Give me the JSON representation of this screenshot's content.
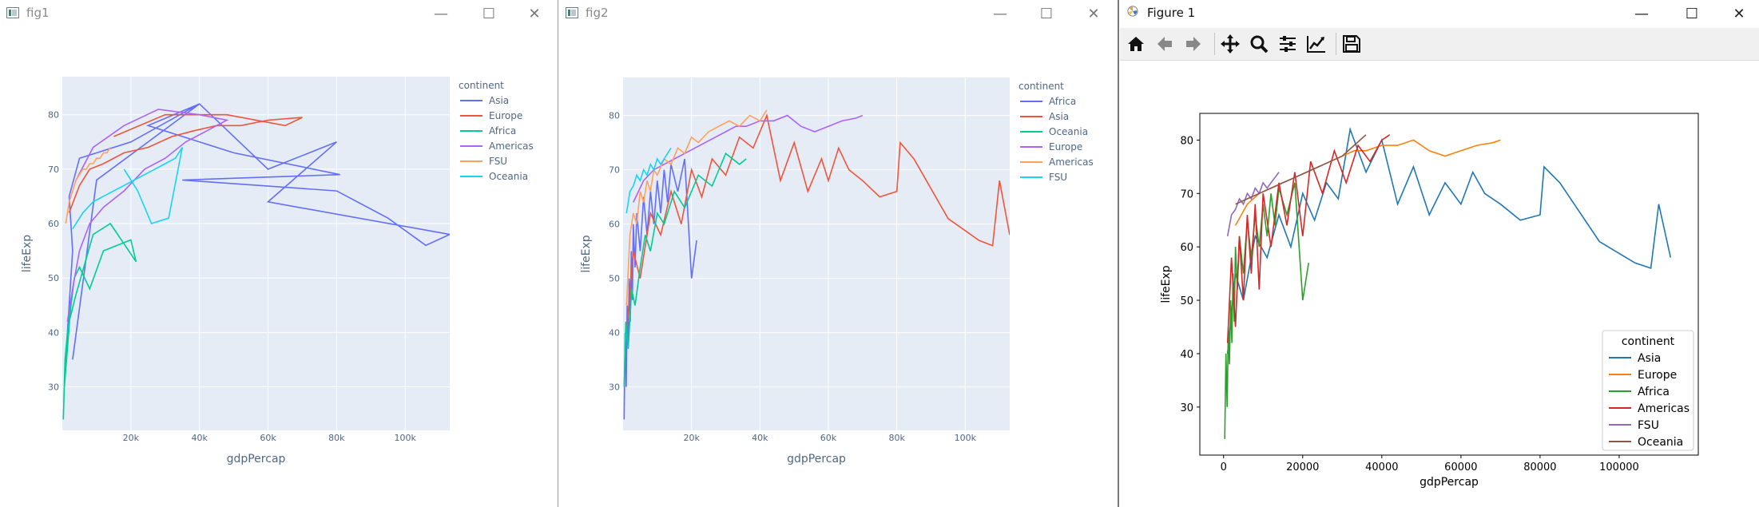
{
  "windows": [
    {
      "title": "fig1",
      "minimize": "—",
      "maximize": "☐",
      "close": "✕"
    },
    {
      "title": "fig2",
      "minimize": "—",
      "maximize": "☐",
      "close": "✕"
    },
    {
      "title": "Figure 1",
      "minimize": "—",
      "maximize": "☐",
      "close": "✕"
    }
  ],
  "toolbar": {
    "items": [
      "home-icon",
      "back-arrow-icon",
      "forward-arrow-icon",
      "pan-move-icon",
      "zoom-magnifier-icon",
      "configure-subplots-icon",
      "edit-axis-icon",
      "save-disk-icon"
    ]
  },
  "colors": {
    "plotly_bg": "#e5ecf6",
    "plotly_text": "#506784",
    "plotly": [
      "#636efa",
      "#EF553B",
      "#00cc96",
      "#ab63fa",
      "#FFA15A",
      "#19d3f3"
    ],
    "mpl": [
      "#1f77b4",
      "#ff7f0e",
      "#2ca02c",
      "#d62728",
      "#9467bd",
      "#8c564b"
    ]
  },
  "chart_data": [
    {
      "id": "fig1",
      "type": "line",
      "xlabel": "gdpPercap",
      "ylabel": "lifeExp",
      "xlim": [
        0,
        113000
      ],
      "ylim": [
        22,
        87
      ],
      "xticks": [
        20000,
        40000,
        60000,
        80000,
        100000
      ],
      "xtick_labels": [
        "20k",
        "40k",
        "60k",
        "80k",
        "100k"
      ],
      "yticks": [
        30,
        40,
        50,
        60,
        70,
        80
      ],
      "ytick_labels": [
        "30",
        "40",
        "50",
        "60",
        "70",
        "80"
      ],
      "legend_title": "continent",
      "series": [
        {
          "name": "Asia",
          "color": "#636efa",
          "x": [
            1500,
            3000,
            2000,
            5000,
            20000,
            40000,
            60000,
            80000,
            60000,
            113000,
            106000,
            95000,
            80000,
            35000,
            81000,
            50000,
            25000,
            40000,
            10000,
            3000
          ],
          "y": [
            40,
            55,
            65,
            72,
            75,
            82,
            70,
            75,
            64,
            58,
            56,
            61,
            66,
            68,
            69,
            73,
            78,
            82,
            68,
            35
          ]
        },
        {
          "name": "Europe",
          "color": "#EF553B",
          "x": [
            2000,
            5000,
            8000,
            12000,
            18000,
            25000,
            32000,
            38000,
            45000,
            52000,
            60000,
            70000,
            65000,
            48000,
            30000,
            15000
          ],
          "y": [
            62,
            67,
            70,
            71,
            73,
            74,
            76,
            77,
            78,
            78,
            79,
            79.5,
            78,
            80,
            80,
            76
          ]
        },
        {
          "name": "Africa",
          "color": "#00cc96",
          "x": [
            300,
            800,
            1500,
            600,
            2500,
            1200,
            3500,
            5000,
            8000,
            12000,
            20000,
            21500,
            14000,
            9000,
            4000,
            2000
          ],
          "y": [
            24,
            35,
            40,
            30,
            45,
            38,
            50,
            52,
            48,
            55,
            57,
            53,
            60,
            58,
            47,
            42
          ]
        },
        {
          "name": "Americas",
          "color": "#ab63fa",
          "x": [
            1500,
            3000,
            5000,
            8000,
            12000,
            18000,
            24000,
            30000,
            36000,
            42000,
            48000,
            40000,
            28000,
            18000,
            9000,
            4000
          ],
          "y": [
            42,
            48,
            55,
            60,
            63,
            66,
            70,
            72,
            75,
            77,
            79,
            80,
            81,
            78,
            74,
            68
          ]
        },
        {
          "name": "FSU",
          "color": "#FFA15A",
          "x": [
            1000,
            2000,
            3000,
            4000,
            5000,
            6000,
            7000,
            8000,
            9000,
            10000,
            11000,
            12000,
            13000,
            14000
          ],
          "y": [
            60,
            64,
            66,
            68,
            69,
            70,
            70,
            71,
            71,
            72,
            72,
            73,
            73,
            74
          ]
        },
        {
          "name": "Oceania",
          "color": "#19d3f3",
          "x": [
            3000,
            6000,
            9000,
            12000,
            15000,
            18000,
            21000,
            24000,
            27000,
            30000,
            33000,
            35000,
            31000,
            26000,
            22000,
            18000
          ],
          "y": [
            59,
            62,
            64,
            65,
            66,
            67,
            68,
            69,
            70,
            71,
            72,
            74,
            61,
            60,
            66,
            70
          ]
        }
      ]
    },
    {
      "id": "fig2",
      "type": "line",
      "xlabel": "gdpPercap",
      "ylabel": "lifeExp",
      "xlim": [
        0,
        113000
      ],
      "ylim": [
        22,
        87
      ],
      "xticks": [
        20000,
        40000,
        60000,
        80000,
        100000
      ],
      "xtick_labels": [
        "20k",
        "40k",
        "60k",
        "80k",
        "100k"
      ],
      "yticks": [
        30,
        40,
        50,
        60,
        70,
        80
      ],
      "ytick_labels": [
        "30",
        "40",
        "50",
        "60",
        "70",
        "80"
      ],
      "legend_title": "continent",
      "series": [
        {
          "name": "Africa",
          "color": "#636efa",
          "x": [
            300,
            600,
            900,
            1200,
            1500,
            1800,
            2100,
            2400,
            2700,
            3000,
            3500,
            4000,
            5000,
            6000,
            7000,
            8000,
            9000,
            10000,
            11000,
            12000,
            13000,
            14000,
            16000,
            18000,
            20000,
            21500
          ],
          "y": [
            24,
            40,
            30,
            45,
            38,
            50,
            42,
            55,
            46,
            60,
            52,
            62,
            55,
            65,
            58,
            66,
            60,
            68,
            62,
            70,
            64,
            71,
            66,
            72,
            50,
            57
          ]
        },
        {
          "name": "Asia",
          "color": "#EF553B",
          "x": [
            1000,
            3000,
            5000,
            8000,
            11000,
            14000,
            17000,
            20000,
            23000,
            26000,
            30000,
            34000,
            38000,
            42000,
            46000,
            50000,
            54000,
            58000,
            60000,
            63000,
            66000,
            70000,
            75000,
            80000,
            81000,
            85000,
            95000,
            104000,
            108000,
            110000,
            113000
          ],
          "y": [
            40,
            55,
            50,
            62,
            58,
            66,
            60,
            70,
            65,
            72,
            69,
            76,
            74,
            80,
            68,
            75,
            66,
            72,
            68,
            74,
            70,
            68,
            65,
            66,
            75,
            72,
            61,
            57,
            56,
            68,
            58
          ]
        },
        {
          "name": "Oceania",
          "color": "#00cc96",
          "x": [
            300,
            800,
            1500,
            2500,
            3500,
            5000,
            6500,
            8000,
            10000,
            12000,
            15000,
            18000,
            22000,
            26000,
            30000,
            34000,
            36000
          ],
          "y": [
            30,
            42,
            37,
            48,
            45,
            52,
            58,
            55,
            62,
            60,
            66,
            63,
            69,
            67,
            73,
            71,
            72
          ]
        },
        {
          "name": "Europe",
          "color": "#ab63fa",
          "x": [
            3000,
            6000,
            9000,
            12000,
            15000,
            18000,
            21000,
            24000,
            27000,
            30000,
            33000,
            36000,
            40000,
            44000,
            48000,
            52000,
            56000,
            60000,
            64000,
            68000,
            70000
          ],
          "y": [
            64,
            68,
            70,
            71,
            72,
            73,
            74,
            75,
            76,
            77,
            78,
            78,
            79,
            79,
            80,
            78,
            77,
            78,
            79,
            79.5,
            80
          ]
        },
        {
          "name": "Americas",
          "color": "#FFA15A",
          "x": [
            1000,
            2000,
            3000,
            4000,
            5000,
            6000,
            7000,
            8000,
            9000,
            10000,
            12000,
            14000,
            16000,
            18000,
            20000,
            22000,
            25000,
            28000,
            31000,
            34000,
            37000,
            40000,
            42000
          ],
          "y": [
            45,
            58,
            62,
            60,
            66,
            64,
            68,
            66,
            70,
            69,
            72,
            71,
            74,
            73,
            76,
            75,
            77,
            78,
            79,
            78,
            80,
            79,
            81
          ]
        },
        {
          "name": "FSU",
          "color": "#19d3f3",
          "x": [
            1000,
            2000,
            3000,
            4000,
            5000,
            6000,
            7000,
            8000,
            9000,
            10000,
            11000,
            12000,
            13000,
            14000
          ],
          "y": [
            62,
            66,
            67,
            69,
            68,
            70,
            69,
            71,
            70,
            72,
            71,
            72,
            73,
            74
          ]
        }
      ]
    },
    {
      "id": "figure1",
      "type": "line",
      "xlabel": "gdpPercap",
      "ylabel": "lifeExp",
      "xlim": [
        -6000,
        120000
      ],
      "ylim": [
        21,
        85
      ],
      "xticks": [
        0,
        20000,
        40000,
        60000,
        80000,
        100000
      ],
      "xtick_labels": [
        "0",
        "20000",
        "40000",
        "60000",
        "80000",
        "100000"
      ],
      "yticks": [
        30,
        40,
        50,
        60,
        70,
        80
      ],
      "ytick_labels": [
        "30",
        "40",
        "50",
        "60",
        "70",
        "80"
      ],
      "legend_title": "continent",
      "series": [
        {
          "name": "Asia",
          "color": "#1f77b4",
          "x": [
            1000,
            3000,
            5000,
            8000,
            11000,
            14000,
            17000,
            20000,
            23000,
            26000,
            29000,
            32000,
            36000,
            40000,
            44000,
            48000,
            52000,
            56000,
            60000,
            63000,
            66000,
            70000,
            75000,
            80000,
            81000,
            85000,
            95000,
            104000,
            108000,
            110000,
            113000
          ],
          "y": [
            40,
            55,
            50,
            62,
            58,
            66,
            60,
            70,
            65,
            72,
            69,
            82,
            74,
            80,
            68,
            75,
            66,
            72,
            68,
            74,
            70,
            68,
            65,
            66,
            75,
            72,
            61,
            57,
            56,
            68,
            58
          ]
        },
        {
          "name": "Europe",
          "color": "#ff7f0e",
          "x": [
            3000,
            6000,
            9000,
            12000,
            15000,
            18000,
            21000,
            24000,
            27000,
            30000,
            33000,
            36000,
            40000,
            44000,
            48000,
            52000,
            56000,
            60000,
            64000,
            68000,
            70000
          ],
          "y": [
            64,
            68,
            70,
            71,
            72,
            73,
            74,
            75,
            76,
            77,
            78,
            78,
            79,
            79,
            80,
            78,
            77,
            78,
            79,
            79.5,
            80
          ]
        },
        {
          "name": "Africa",
          "color": "#2ca02c",
          "x": [
            300,
            600,
            900,
            1200,
            1500,
            1800,
            2100,
            2400,
            2700,
            3000,
            3500,
            4000,
            5000,
            6000,
            7000,
            8000,
            9000,
            10000,
            11000,
            12000,
            13000,
            14000,
            16000,
            18000,
            20000,
            21500
          ],
          "y": [
            24,
            40,
            30,
            45,
            38,
            50,
            42,
            55,
            46,
            60,
            52,
            62,
            55,
            65,
            58,
            66,
            60,
            68,
            62,
            70,
            64,
            71,
            66,
            72,
            50,
            57
          ]
        },
        {
          "name": "Americas",
          "color": "#d62728",
          "x": [
            1000,
            2000,
            3000,
            4000,
            5000,
            6000,
            7000,
            8000,
            9000,
            10000,
            12000,
            14000,
            16000,
            18000,
            20000,
            22000,
            25000,
            28000,
            31000,
            34000,
            37000,
            40000,
            42000
          ],
          "y": [
            42,
            58,
            45,
            62,
            50,
            66,
            55,
            68,
            52,
            70,
            60,
            72,
            64,
            74,
            62,
            76,
            70,
            78,
            72,
            79,
            76,
            80,
            81
          ]
        },
        {
          "name": "FSU",
          "color": "#9467bd",
          "x": [
            1000,
            2000,
            3000,
            4000,
            5000,
            6000,
            7000,
            8000,
            9000,
            10000,
            11000,
            12000,
            13000,
            14000
          ],
          "y": [
            62,
            66,
            67,
            69,
            68,
            70,
            69,
            71,
            70,
            72,
            71,
            72,
            73,
            74
          ]
        },
        {
          "name": "Oceania",
          "color": "#8c564b",
          "x": [
            3000,
            6000,
            9000,
            12000,
            15000,
            18000,
            21000,
            24000,
            27000,
            30000,
            33000,
            36000
          ],
          "y": [
            68,
            69,
            70,
            71,
            72,
            73,
            74,
            75,
            76,
            77,
            79,
            81
          ]
        }
      ]
    }
  ]
}
